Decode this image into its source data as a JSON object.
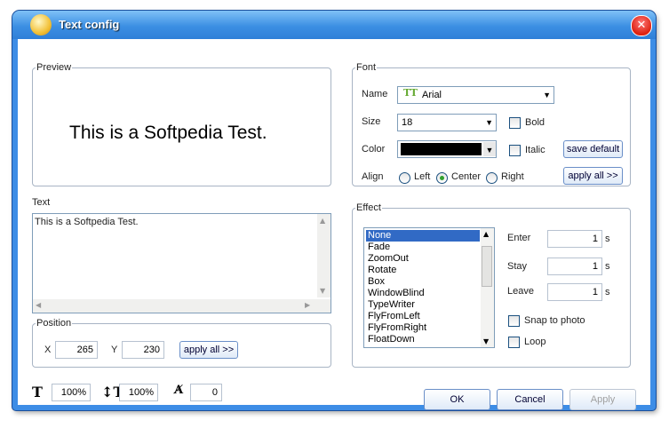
{
  "window": {
    "title": "Text config"
  },
  "preview": {
    "legend": "Preview",
    "text": "This is a Softpedia Test."
  },
  "text_section": {
    "legend": "Text",
    "value": "This is a Softpedia Test."
  },
  "position": {
    "legend": "Position",
    "x_label": "X",
    "x_value": "265",
    "y_label": "Y",
    "y_value": "230",
    "apply_all": "apply all >>"
  },
  "scales": {
    "width_value": "100%",
    "height_value": "100%",
    "angle_value": "0"
  },
  "font": {
    "legend": "Font",
    "name_label": "Name",
    "name_value": "Arial",
    "size_label": "Size",
    "size_value": "18",
    "color_label": "Color",
    "align_label": "Align",
    "bold": "Bold",
    "italic": "Italic",
    "save_default": "save default",
    "apply_all": "apply all >>",
    "align_options": [
      "Left",
      "Center",
      "Right"
    ],
    "align_selected": "Center",
    "color_value": "#000000"
  },
  "effect": {
    "legend": "Effect",
    "items": [
      "None",
      "Fade",
      "ZoomOut",
      "Rotate",
      "Box",
      "WindowBlind",
      "TypeWriter",
      "FlyFromLeft",
      "FlyFromRight",
      "FloatDown"
    ],
    "selected": "None",
    "enter_label": "Enter",
    "enter_value": "1",
    "stay_label": "Stay",
    "stay_value": "1",
    "leave_label": "Leave",
    "leave_value": "1",
    "unit": "s",
    "snap_label": "Snap to photo",
    "loop_label": "Loop"
  },
  "buttons": {
    "ok": "OK",
    "cancel": "Cancel",
    "apply": "Apply"
  }
}
